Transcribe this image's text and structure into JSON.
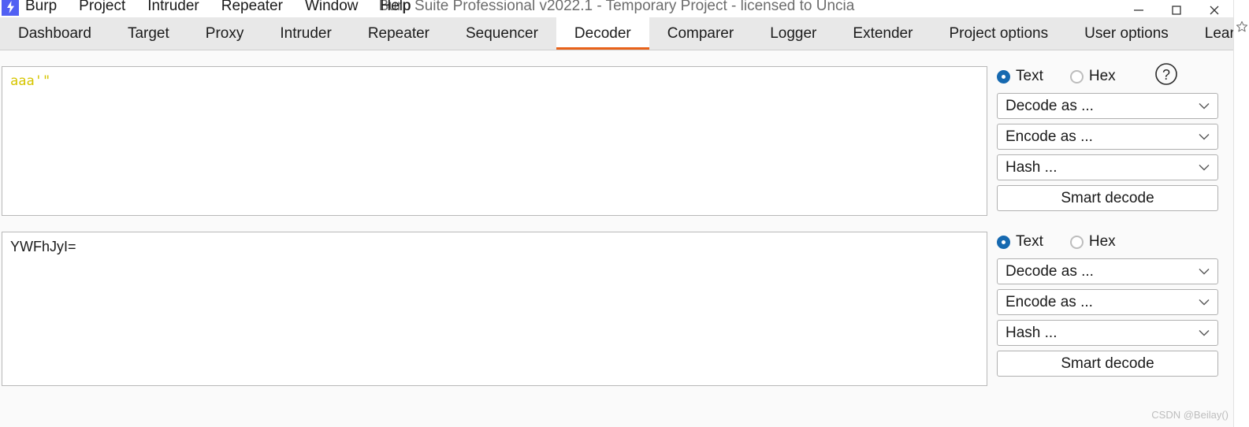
{
  "window": {
    "title": "Burp Suite Professional v2022.1 - Temporary Project - licensed to Uncia",
    "logo_icon": "burp-lightning-icon",
    "minimize_icon": "minimize-icon",
    "maximize_icon": "maximize-icon",
    "close_icon": "close-icon"
  },
  "browser": {
    "bookmark_icon": "star-icon"
  },
  "menubar": {
    "items": [
      {
        "label": "Burp"
      },
      {
        "label": "Project"
      },
      {
        "label": "Intruder"
      },
      {
        "label": "Repeater"
      },
      {
        "label": "Window"
      },
      {
        "label": "Help"
      }
    ]
  },
  "tabs": {
    "active": "Decoder",
    "items": [
      {
        "label": "Dashboard",
        "active": false
      },
      {
        "label": "Target",
        "active": false
      },
      {
        "label": "Proxy",
        "active": false
      },
      {
        "label": "Intruder",
        "active": false
      },
      {
        "label": "Repeater",
        "active": false
      },
      {
        "label": "Sequencer",
        "active": false
      },
      {
        "label": "Decoder",
        "active": true
      },
      {
        "label": "Comparer",
        "active": false
      },
      {
        "label": "Logger",
        "active": false
      },
      {
        "label": "Extender",
        "active": false
      },
      {
        "label": "Project options",
        "active": false
      },
      {
        "label": "User options",
        "active": false
      },
      {
        "label": "Learn",
        "active": false
      }
    ]
  },
  "decoder": {
    "panels": [
      {
        "text_value": "aaa'\"",
        "text_color": "#d6c500",
        "mode_text_label": "Text",
        "mode_hex_label": "Hex",
        "mode_selected": "Text",
        "has_help": true,
        "help_glyph": "?",
        "decode_label": "Decode as ...",
        "encode_label": "Encode as ...",
        "hash_label": "Hash ...",
        "smart_decode_label": "Smart decode"
      },
      {
        "text_value": "YWFhJyI=",
        "text_color": "#1a1a1a",
        "mode_text_label": "Text",
        "mode_hex_label": "Hex",
        "mode_selected": "Text",
        "has_help": false,
        "help_glyph": "",
        "decode_label": "Decode as ...",
        "encode_label": "Encode as ...",
        "hash_label": "Hash ...",
        "smart_decode_label": "Smart decode"
      }
    ]
  },
  "accent": {
    "tab_underline": "#e8621a",
    "radio_selected": "#1669b0",
    "logo_bg": "#5160f3"
  },
  "watermark": {
    "text": "CSDN @Beilay()"
  }
}
